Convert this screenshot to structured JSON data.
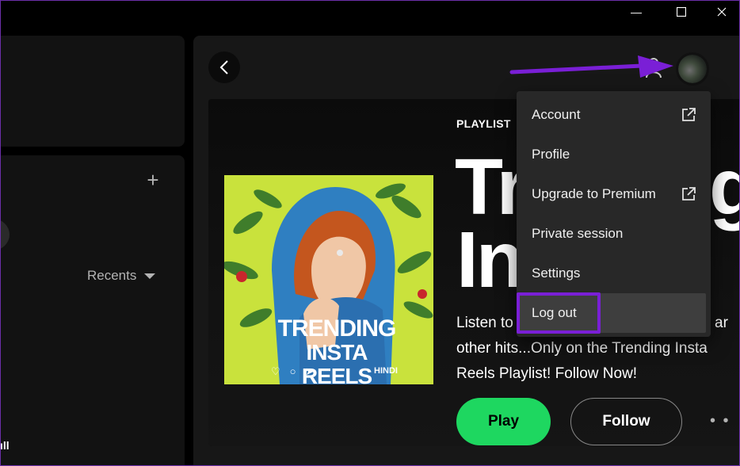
{
  "window": {
    "minimize_glyph": "—",
    "maximize_glyph": "☐",
    "close_glyph": "✕"
  },
  "library": {
    "add_glyph": "+",
    "sort_label": "Recents",
    "bottom_partial_text": "ıll"
  },
  "playlist": {
    "type_label": "PLAYLIST",
    "title_line1": "Tr",
    "title_line2": "In",
    "title_trailing": "g",
    "description_line1": "Listen to",
    "description_tail": "ar",
    "description_line2": "other hits...Only on the Trending Insta",
    "description_line3": "Reels Playlist! Follow Now!",
    "cover": {
      "title_line1": "TRENDING",
      "title_line2": "INSTA REELS",
      "tag": "HINDI",
      "colors": {
        "background": "#c9e23c",
        "scarf": "#2f7fc1",
        "hair": "#c4561e",
        "skin": "#f0c7a6",
        "leaves": "#3f7d2b"
      }
    },
    "actions": {
      "play_label": "Play",
      "follow_label": "Follow",
      "more_glyph": "• •"
    }
  },
  "profile_menu": {
    "items": [
      {
        "label": "Account",
        "external": true
      },
      {
        "label": "Profile",
        "external": false
      },
      {
        "label": "Upgrade to Premium",
        "external": true
      },
      {
        "label": "Private session",
        "external": false
      },
      {
        "label": "Settings",
        "external": false
      },
      {
        "label": "Log out",
        "external": false
      }
    ]
  },
  "colors": {
    "accent_green": "#1ed760",
    "annotation_purple": "#7a1fd6",
    "menu_bg": "#282828",
    "menu_hover": "#3e3e3e"
  }
}
